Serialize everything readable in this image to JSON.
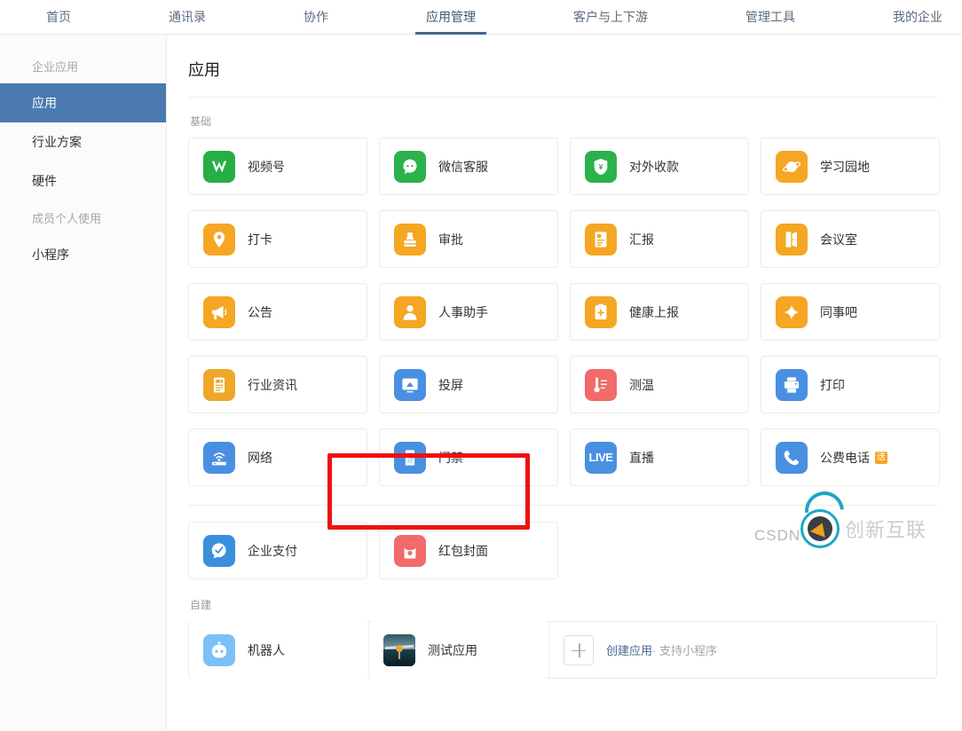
{
  "topnav": {
    "items": [
      {
        "label": "首页",
        "active": false
      },
      {
        "label": "通讯录",
        "active": false
      },
      {
        "label": "协作",
        "active": false
      },
      {
        "label": "应用管理",
        "active": true
      },
      {
        "label": "客户与上下游",
        "active": false
      },
      {
        "label": "管理工具",
        "active": false
      },
      {
        "label": "我的企业",
        "active": false
      }
    ]
  },
  "sidebar": {
    "group1_label": "企业应用",
    "items1": [
      {
        "label": "应用",
        "active": true
      },
      {
        "label": "行业方案",
        "active": false
      },
      {
        "label": "硬件",
        "active": false
      }
    ],
    "group2_label": "成员个人使用",
    "items2": [
      {
        "label": "小程序",
        "active": false
      }
    ]
  },
  "main": {
    "page_title": "应用",
    "section_basic": "基础",
    "section_selfbuilt": "自建",
    "basic_apps": [
      {
        "name": "视频号",
        "icon": "channels-icon",
        "color": "#27ae45",
        "badge": ""
      },
      {
        "name": "微信客服",
        "icon": "wechat-service-icon",
        "color": "#2bb24c",
        "badge": ""
      },
      {
        "name": "对外收款",
        "icon": "external-payment-icon",
        "color": "#2bb24c",
        "badge": ""
      },
      {
        "name": "学习园地",
        "icon": "learning-icon",
        "color": "#f5a623",
        "badge": ""
      },
      {
        "name": "打卡",
        "icon": "checkin-pin-icon",
        "color": "#f5a623",
        "badge": ""
      },
      {
        "name": "审批",
        "icon": "approval-stamp-icon",
        "color": "#f5a623",
        "badge": ""
      },
      {
        "name": "汇报",
        "icon": "report-doc-icon",
        "color": "#f5a623",
        "badge": ""
      },
      {
        "name": "会议室",
        "icon": "meeting-room-door-icon",
        "color": "#f5a623",
        "badge": ""
      },
      {
        "name": "公告",
        "icon": "announcement-megaphone-icon",
        "color": "#f5a623",
        "badge": ""
      },
      {
        "name": "人事助手",
        "icon": "hr-assistant-person-icon",
        "color": "#f5a623",
        "badge": ""
      },
      {
        "name": "健康上报",
        "icon": "health-report-clipboard-icon",
        "color": "#f5a623",
        "badge": ""
      },
      {
        "name": "同事吧",
        "icon": "colleague-forum-icon",
        "color": "#f5a623",
        "badge": ""
      },
      {
        "name": "行业资讯",
        "icon": "industry-news-icon",
        "color": "#f0a62b",
        "badge": ""
      },
      {
        "name": "投屏",
        "icon": "screencast-icon",
        "color": "#4a90e2",
        "badge": ""
      },
      {
        "name": "测温",
        "icon": "temperature-thermometer-icon",
        "color": "#f26a6a",
        "badge": ""
      },
      {
        "name": "打印",
        "icon": "printer-icon",
        "color": "#4a90e2",
        "badge": ""
      },
      {
        "name": "网络",
        "icon": "network-wifi-icon",
        "color": "#4a90e2",
        "badge": ""
      },
      {
        "name": "门禁",
        "icon": "access-control-door-icon",
        "color": "#4a90e2",
        "badge": ""
      },
      {
        "name": "直播",
        "icon": "live-icon",
        "color": "#4a90e2",
        "badge": ""
      },
      {
        "name": "公费电话",
        "icon": "phone-call-icon",
        "color": "#4a90e2",
        "badge": "送"
      }
    ],
    "payment_apps": [
      {
        "name": "企业支付",
        "icon": "enterprise-pay-check-icon",
        "color": "#3a8fdc",
        "badge": ""
      },
      {
        "name": "红包封面",
        "icon": "red-packet-cover-icon",
        "color": "#f26a6a",
        "badge": ""
      }
    ],
    "selfbuilt_apps": [
      {
        "name": "机器人",
        "icon": "robot-icon",
        "color": "#7cc0f7",
        "badge": ""
      },
      {
        "name": "测试应用",
        "icon": "photo-thumbnail-icon",
        "color": "#16404b",
        "badge": ""
      }
    ],
    "create_app": {
      "label": "创建应用",
      "sub_label": "· 支持小程序"
    }
  },
  "annotation": {
    "highlight_color": "#ee1111"
  },
  "watermarks": {
    "csdn": "CSDN",
    "brand": "创新互联"
  }
}
